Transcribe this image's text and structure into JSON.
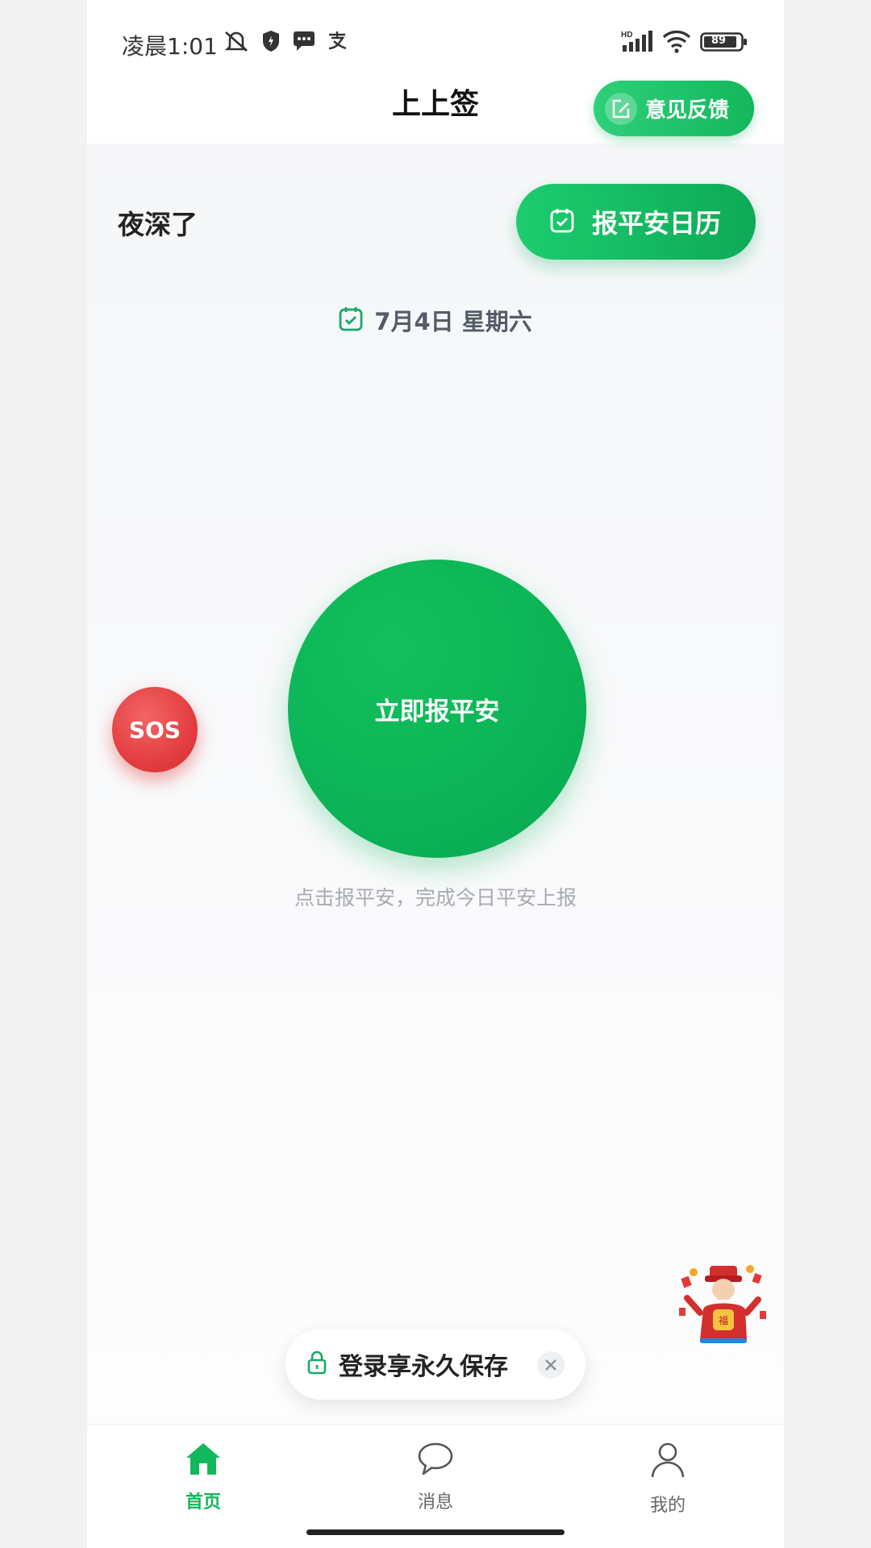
{
  "status_bar": {
    "time": "凌晨1:01",
    "battery": "89",
    "network": "HD"
  },
  "header": {
    "title": "上上签",
    "feedback_label": "意见反馈"
  },
  "greeting": "夜深了",
  "calendar_button_label": "报平安日历",
  "date": "7月4日 星期六",
  "report_button_label": "立即报平安",
  "hint": "点击报平安，完成今日平安上报",
  "sos_label": "SOS",
  "login_toast": {
    "label": "登录享永久保存"
  },
  "tabs": [
    {
      "label": "首页",
      "icon": "home-icon",
      "active": true
    },
    {
      "label": "消息",
      "icon": "chat-bubble-icon",
      "active": false
    },
    {
      "label": "我的",
      "icon": "user-icon",
      "active": false
    }
  ],
  "colors": {
    "accent": "#13b75c",
    "sos": "#e23b3e",
    "tab_inactive": "#666666"
  }
}
